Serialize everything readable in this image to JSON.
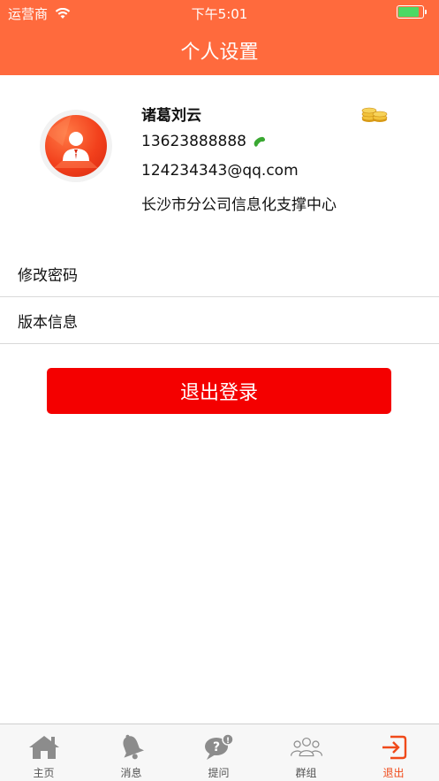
{
  "status_bar": {
    "carrier": "运营商",
    "time": "下午5:01",
    "battery_level": 0.9
  },
  "header": {
    "title": "个人设置"
  },
  "profile": {
    "name": "诸葛刘云",
    "phone": "13623888888",
    "email": "124234343@qq.com",
    "department": "长沙市分公司信息化支撑中心"
  },
  "menu": [
    {
      "label": "修改密码"
    },
    {
      "label": "版本信息"
    }
  ],
  "logout_label": "退出登录",
  "tabs": [
    {
      "label": "主页",
      "icon": "home-icon"
    },
    {
      "label": "消息",
      "icon": "bell-icon"
    },
    {
      "label": "提问",
      "icon": "question-bubble-icon"
    },
    {
      "label": "群组",
      "icon": "group-icon"
    },
    {
      "label": "退出",
      "icon": "exit-icon",
      "active": true
    }
  ],
  "colors": {
    "header": "#ff6a3d",
    "logout_button": "#f40000",
    "active_tab": "#f04a1a",
    "inactive_tab": "#888888",
    "phone_icon": "#3aa832"
  }
}
